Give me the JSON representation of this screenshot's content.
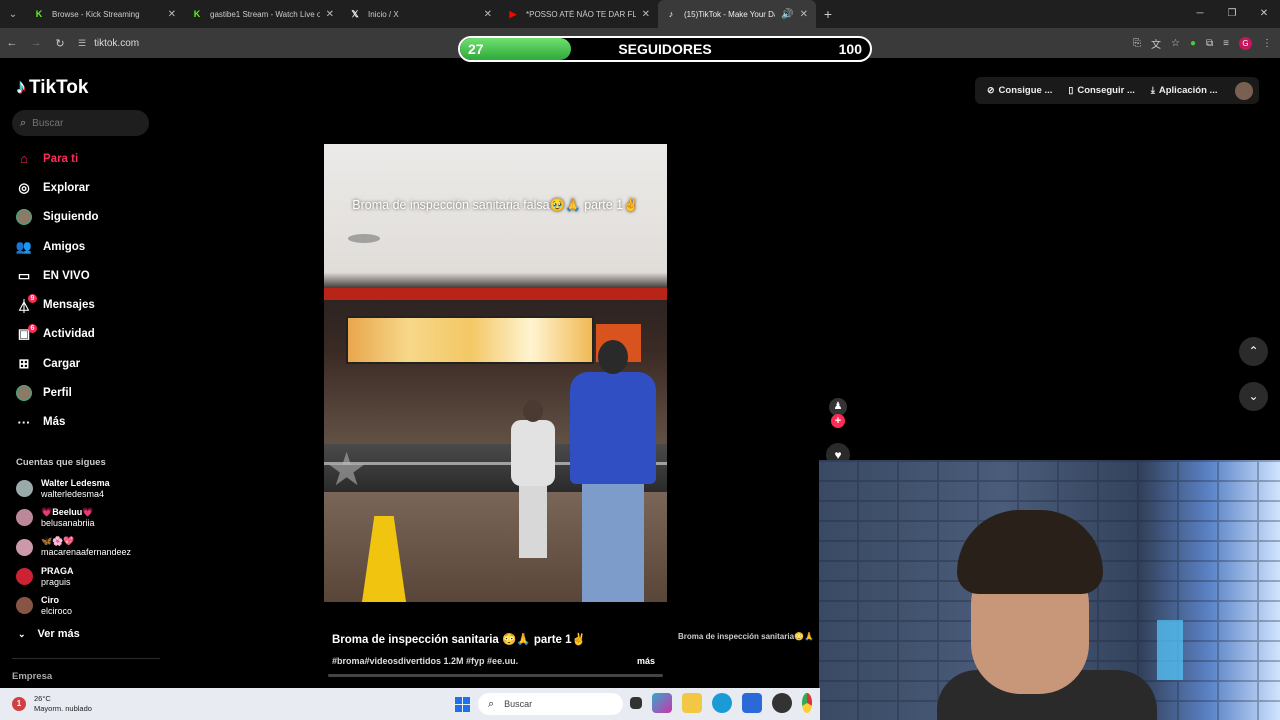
{
  "browser": {
    "tabs": [
      {
        "title": "Browse - Kick Streaming",
        "icon": "K",
        "icon_color": "#53fc18",
        "active": false
      },
      {
        "title": "gastibe1 Stream - Watch Live o",
        "icon": "K",
        "icon_color": "#53fc18",
        "active": false
      },
      {
        "title": "Inicio / X",
        "icon": "𝕏",
        "icon_color": "#ffffff",
        "active": false
      },
      {
        "title": "*POSSO ATÉ NÃO TE DAR FLOR",
        "icon": "▶",
        "icon_color": "#ff0000",
        "active": false
      },
      {
        "title": "(15)TikTok - Make Your Day",
        "icon": "♪",
        "icon_color": "#ffffff",
        "active": true
      }
    ],
    "url": "tiktok.com"
  },
  "overlay": {
    "current": "27",
    "label": "SEGUIDORES",
    "goal": "100",
    "progress": 0.27
  },
  "tiktok": {
    "logo": "TikTok",
    "search_placeholder": "Buscar",
    "nav": [
      {
        "label": "Para ti",
        "icon": "home-icon",
        "active": true
      },
      {
        "label": "Explorar",
        "icon": "compass-icon"
      },
      {
        "label": "Siguiendo",
        "icon": "avatar"
      },
      {
        "label": "Amigos",
        "icon": "friends-icon"
      },
      {
        "label": "EN VIVO",
        "icon": "live-icon"
      },
      {
        "label": "Mensajes",
        "icon": "messages-icon",
        "badge": "9"
      },
      {
        "label": "Actividad",
        "icon": "activity-icon",
        "badge": "6"
      },
      {
        "label": "Cargar",
        "icon": "upload-icon"
      },
      {
        "label": "Perfil",
        "icon": "avatar"
      },
      {
        "label": "Más",
        "icon": "more-icon"
      }
    ],
    "following_title": "Cuentas que sigues",
    "following": [
      {
        "name": "Walter Ledesma",
        "handle": "walterledesma4"
      },
      {
        "name": "💗Beeluu💗",
        "handle": "belusanabriia"
      },
      {
        "name": "🦋🌸💖",
        "handle": "macarenaafernandeez"
      },
      {
        "name": "PRAGA",
        "handle": "praguis"
      },
      {
        "name": "Ciro",
        "handle": "elciroco"
      }
    ],
    "see_more": "Ver más",
    "empresa": "Empresa",
    "top_buttons": [
      {
        "label": "Consigue ...",
        "icon": "coin-icon"
      },
      {
        "label": "Conseguir ...",
        "icon": "phone-icon"
      },
      {
        "label": "Aplicación ...",
        "icon": "download-icon"
      }
    ],
    "video": {
      "caption": "Broma de inspección sanitaria falsa🥹🙏 parte 1✌️",
      "title": "Broma de inspección sanitaria 😳🙏 parte 1✌️",
      "tags": "#broma#videosdivertidos 1.2M #fyp #ee.uu.",
      "more": "más",
      "next_title": "Broma de inspección sanitaria😳🙏"
    }
  },
  "taskbar": {
    "weather_temp": "26°C",
    "weather_desc": "Mayorm. nublado",
    "weather_badge": "1",
    "search": "Buscar"
  }
}
